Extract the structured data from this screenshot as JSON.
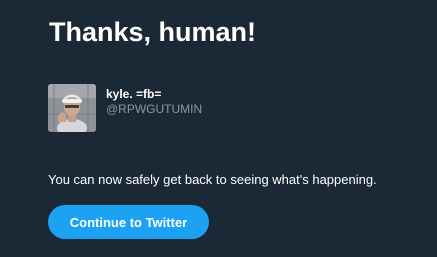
{
  "page": {
    "title": "Thanks, human!",
    "message": "You can now safely get back to seeing what's happening."
  },
  "user": {
    "display_name": "kyle. =fb=",
    "handle": "@RPWGUTUMIN",
    "avatar_icon": "profile-photo"
  },
  "actions": {
    "continue_label": "Continue to Twitter"
  },
  "colors": {
    "background": "#1b2836",
    "text": "#ffffff",
    "muted_text": "#8899a6",
    "accent": "#1da1f2"
  }
}
